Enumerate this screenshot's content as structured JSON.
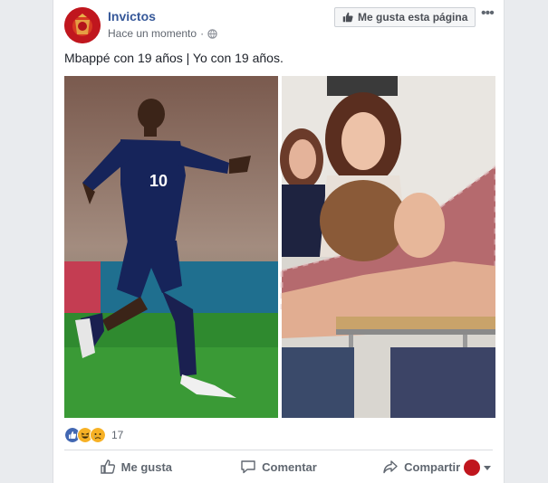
{
  "post": {
    "page_name": "Invictos",
    "timestamp": "Hace un momento",
    "separator": "·",
    "like_page_label": "Me gusta esta página",
    "text": "Mbappé con 19 años | Yo con 19 años.",
    "reaction_count": "17",
    "reactions": [
      "like-reaction-icon",
      "haha-reaction-icon",
      "sad-reaction-icon"
    ],
    "actions": {
      "like": "Me gusta",
      "comment": "Comentar",
      "share": "Compartir"
    },
    "photo": {
      "left": "football-player-celebrating",
      "right": "student-sleeping-on-desk",
      "left_jersey_number": "10"
    }
  },
  "colors": {
    "page_background": "#e9ebee",
    "link": "#365899",
    "secondary_text": "#616770",
    "like_blue": "#4267b2"
  }
}
